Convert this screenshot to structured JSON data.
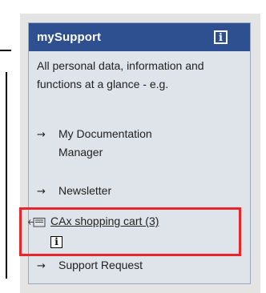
{
  "widget": {
    "title": "mySupport",
    "description": "All personal data, information and functions at a glance - e.g.",
    "links": [
      {
        "arrow": "→",
        "label_line1": "My Documentation",
        "label_line2": "Manager"
      },
      {
        "arrow": "→",
        "label_line1": "Newsletter"
      },
      {
        "arrow": "→",
        "label_line1": "Support Request"
      }
    ],
    "cart": {
      "label": "CAx shopping cart (3)",
      "info_glyph": "i"
    },
    "header_info_glyph": "i"
  },
  "colors": {
    "header_bg": "#2e4f90",
    "box_bg": "#dfe3ea",
    "highlight_border": "#e8262b"
  },
  "icons": {
    "header": "info-icon",
    "cart": "cart-arrow-icon",
    "cart_info": "info-icon"
  }
}
